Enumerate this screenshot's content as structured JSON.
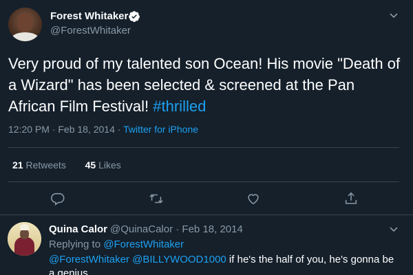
{
  "tweet": {
    "author_name": "Forest Whitaker",
    "author_handle": "@ForestWhitaker",
    "text_main": "Very proud of my talented son Ocean! His movie \"Death of a Wizard\" has been selected & screened at the Pan African Film Festival! ",
    "hashtag": "#thrilled",
    "timestamp": "12:20 PM · Feb 18, 2014 · ",
    "source": "Twitter for iPhone",
    "retweets_count": "21",
    "retweets_label": " Retweets",
    "likes_count": "45",
    "likes_label": " Likes"
  },
  "icons": {
    "verified": "verified-badge-icon",
    "caret": "chevron-down-icon",
    "reply": "reply-icon",
    "retweet": "retweet-icon",
    "like": "heart-icon",
    "share": "share-icon"
  },
  "reply": {
    "author_name": "Quina Calor",
    "meta": "@QuinaCalor · Feb 18, 2014",
    "replying_prefix": "Replying to ",
    "replying_to": "@ForestWhitaker",
    "mention_1": "@ForestWhitaker",
    "mention_2": "@BILLYWOOD1000",
    "text": " if he's the half of you, he's gonna be a genius"
  },
  "colors": {
    "background": "#15202b",
    "accent": "#1da1f2",
    "secondary_text": "#8899a6",
    "divider": "#38444d"
  }
}
